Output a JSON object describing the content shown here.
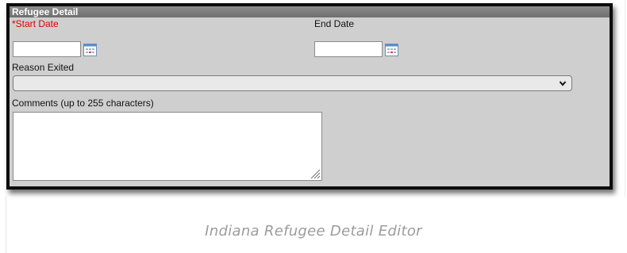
{
  "panel": {
    "title": "Refugee Detail"
  },
  "fields": {
    "start_date_label": "*Start Date",
    "start_date_value": "",
    "end_date_label": "End Date",
    "end_date_value": "",
    "reason_exited_label": "Reason Exited",
    "reason_exited_value": "",
    "comments_label": "Comments (up to 255 characters)",
    "comments_value": ""
  },
  "icons": {
    "calendar": "calendar-icon",
    "dropdown": "chevron-down-icon",
    "resize": "resize-grip-icon"
  },
  "colors": {
    "required_label": "#e00000",
    "panel_background": "#cfcfcf",
    "header_background": "#7d7d7d"
  },
  "caption": "Indiana Refugee Detail Editor"
}
